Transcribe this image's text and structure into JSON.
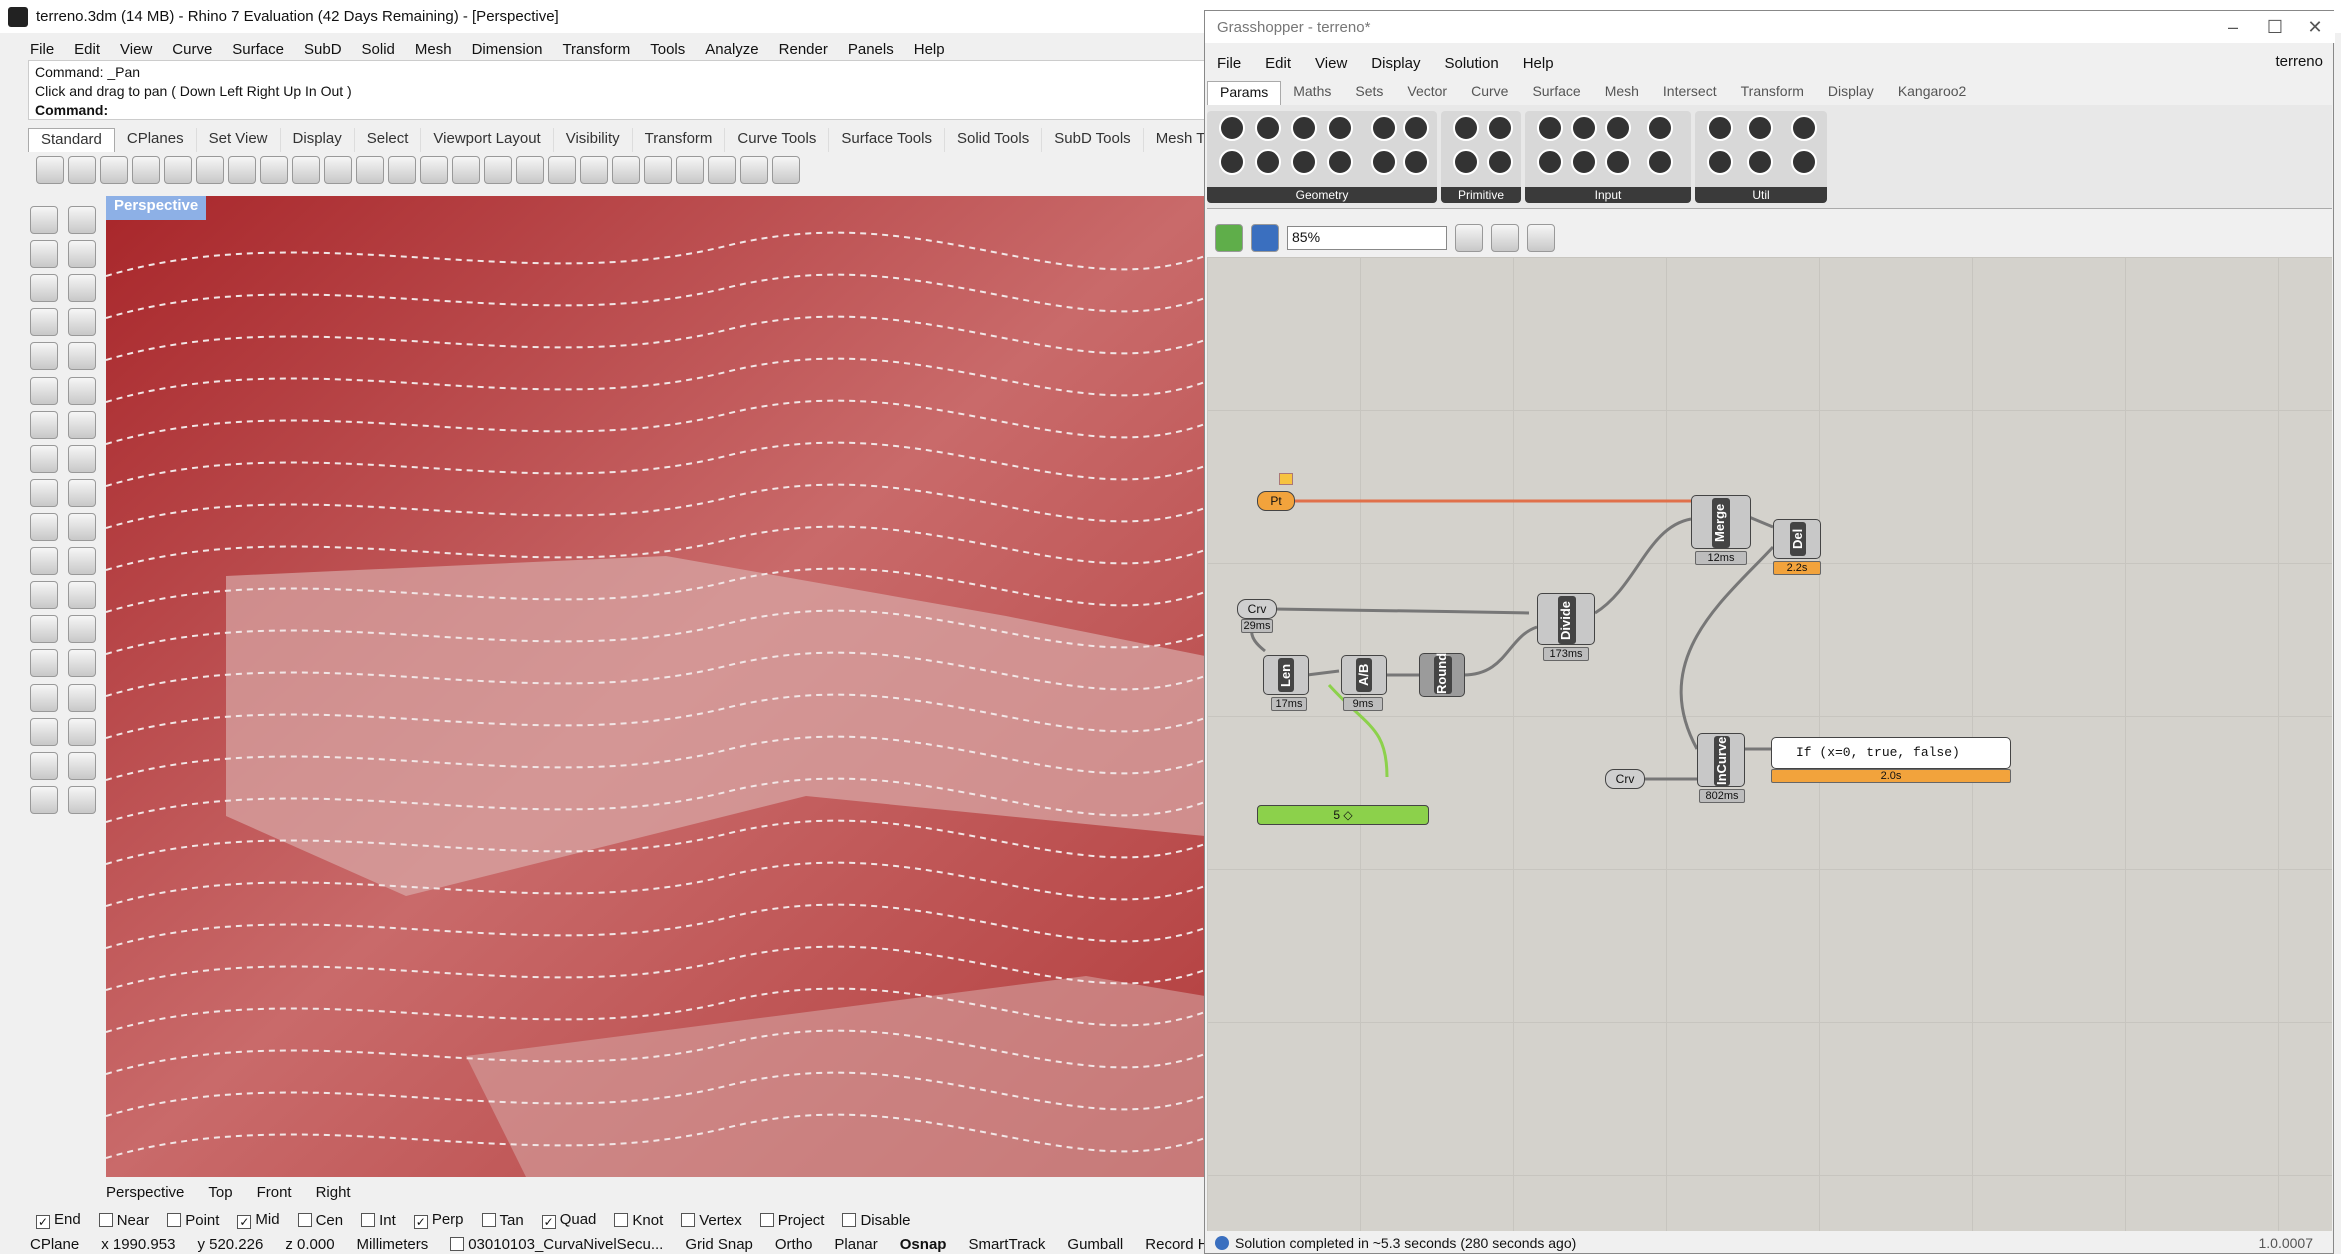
{
  "rhino": {
    "title": "terreno.3dm (14 MB) - Rhino 7 Evaluation (42 Days Remaining) - [Perspective]",
    "menu": [
      "File",
      "Edit",
      "View",
      "Curve",
      "Surface",
      "SubD",
      "Solid",
      "Mesh",
      "Dimension",
      "Transform",
      "Tools",
      "Analyze",
      "Render",
      "Panels",
      "Help"
    ],
    "command_history": [
      "Command: _Pan",
      "Click and drag to pan ( Down  Left  Right  Up  In  Out )"
    ],
    "command_prompt": "Command:",
    "toolbar_tabs": [
      "Standard",
      "CPlanes",
      "Set View",
      "Display",
      "Select",
      "Viewport Layout",
      "Visibility",
      "Transform",
      "Curve Tools",
      "Surface Tools",
      "Solid Tools",
      "SubD Tools",
      "Mesh Tools"
    ],
    "viewport_label": "Perspective",
    "viewport_tabs": [
      "Perspective",
      "Top",
      "Front",
      "Right"
    ],
    "osnaps": [
      {
        "label": "End",
        "checked": true
      },
      {
        "label": "Near",
        "checked": false
      },
      {
        "label": "Point",
        "checked": false
      },
      {
        "label": "Mid",
        "checked": true
      },
      {
        "label": "Cen",
        "checked": false
      },
      {
        "label": "Int",
        "checked": false
      },
      {
        "label": "Perp",
        "checked": true
      },
      {
        "label": "Tan",
        "checked": false
      },
      {
        "label": "Quad",
        "checked": true
      },
      {
        "label": "Knot",
        "checked": false
      },
      {
        "label": "Vertex",
        "checked": false
      },
      {
        "label": "Project",
        "checked": false
      },
      {
        "label": "Disable",
        "checked": false
      }
    ],
    "status": {
      "cplane": "CPlane",
      "x": "x 1990.953",
      "y": "y 520.226",
      "z": "z 0.000",
      "units": "Millimeters",
      "layer": "03010103_CurvaNivelSecu...",
      "grid_snap": "Grid Snap",
      "ortho": "Ortho",
      "planar": "Planar",
      "osnap": "Osnap",
      "smarttrack": "SmartTrack",
      "gumball": "Gumball",
      "record": "Record Hist"
    }
  },
  "gh": {
    "title": "Grasshopper - terreno*",
    "menu": [
      "File",
      "Edit",
      "View",
      "Display",
      "Solution",
      "Help"
    ],
    "user": "terreno",
    "tabs": [
      "Params",
      "Maths",
      "Sets",
      "Vector",
      "Curve",
      "Surface",
      "Mesh",
      "Intersect",
      "Transform",
      "Display",
      "Kangaroo2"
    ],
    "groups": [
      "Geometry",
      "Primitive",
      "Input",
      "Util"
    ],
    "zoom": "85%",
    "components": {
      "pt": "Pt",
      "crv1": "Crv",
      "crv2": "Crv",
      "len": "Len",
      "ab": "A/B",
      "round": "Round",
      "divide": "Divide",
      "merge": "Merge",
      "del": "Del",
      "incurve": "InCurve",
      "expr": "If (x=0, true, false)",
      "slider": "5 ◇"
    },
    "timers": {
      "crv1": "29ms",
      "len": "17ms",
      "ab": "9ms",
      "divide": "173ms",
      "merge": "12ms",
      "del": "2.2s",
      "incurve": "802ms",
      "expr": "2.0s"
    },
    "status": "Solution completed in ~5.3 seconds (280 seconds ago)",
    "version": "1.0.0007"
  }
}
